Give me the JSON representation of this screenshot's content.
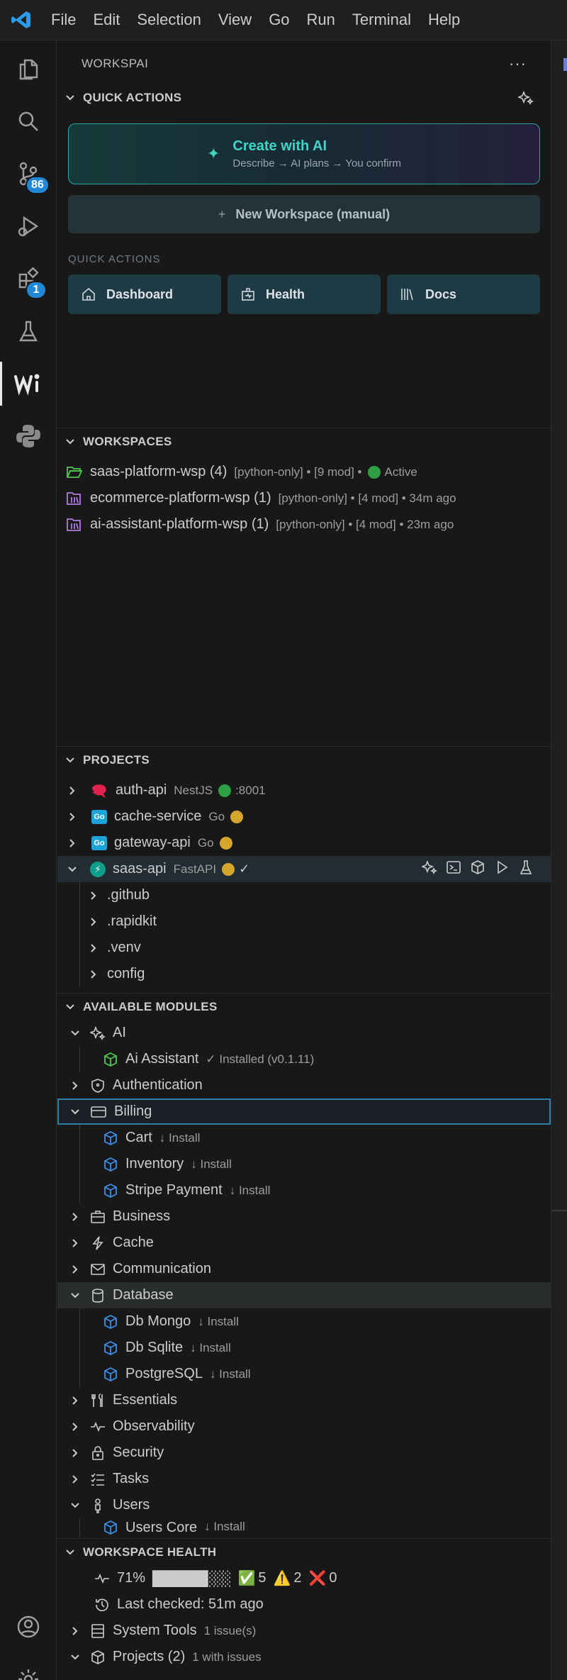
{
  "menu": [
    "File",
    "Edit",
    "Selection",
    "View",
    "Go",
    "Run",
    "Terminal",
    "Help"
  ],
  "activity": {
    "scm_badge": "86",
    "extensions_badge": "1"
  },
  "sidebar": {
    "title": "WORKSPAI",
    "more": "···"
  },
  "quick_actions": {
    "header": "QUICK ACTIONS",
    "create_ai_title": "Create with AI",
    "create_ai_subtitle": "Describe → AI plans → You confirm",
    "new_workspace": "New Workspace (manual)",
    "sublabel": "QUICK ACTIONS",
    "buttons": [
      "Dashboard",
      "Health",
      "Docs"
    ]
  },
  "workspaces": {
    "header": "WORKSPACES",
    "items": [
      {
        "name": "saas-platform-wsp (4)",
        "meta": "[python-only] • [9 mod] •",
        "status": "Active"
      },
      {
        "name": "ecommerce-platform-wsp (1)",
        "meta": "[python-only] • [4 mod] • 34m ago"
      },
      {
        "name": "ai-assistant-platform-wsp (1)",
        "meta": "[python-only] • [4 mod] • 23m ago"
      }
    ]
  },
  "projects": {
    "header": "PROJECTS",
    "items": [
      {
        "name": "auth-api",
        "framework": "NestJS",
        "port": ":8001"
      },
      {
        "name": "cache-service",
        "framework": "Go"
      },
      {
        "name": "gateway-api",
        "framework": "Go"
      },
      {
        "name": "saas-api",
        "framework": "FastAPI",
        "check": "✓"
      }
    ],
    "children": [
      ".github",
      ".rapidkit",
      ".venv",
      "config"
    ]
  },
  "modules": {
    "header": "AVAILABLE MODULES",
    "ai": "AI",
    "ai_assistant": "Ai Assistant",
    "ai_assistant_status": "✓ Installed (v0.1.11)",
    "authentication": "Authentication",
    "billing": "Billing",
    "billing_items": [
      {
        "name": "Cart",
        "action": "↓ Install"
      },
      {
        "name": "Inventory",
        "action": "↓ Install"
      },
      {
        "name": "Stripe Payment",
        "action": "↓ Install"
      }
    ],
    "business": "Business",
    "cache": "Cache",
    "communication": "Communication",
    "database": "Database",
    "database_items": [
      {
        "name": "Db Mongo",
        "action": "↓ Install"
      },
      {
        "name": "Db Sqlite",
        "action": "↓ Install"
      },
      {
        "name": "PostgreSQL",
        "action": "↓ Install"
      }
    ],
    "essentials": "Essentials",
    "observability": "Observability",
    "security": "Security",
    "tasks": "Tasks",
    "users": "Users",
    "users_core": "Users Core",
    "users_core_action": "↓ Install"
  },
  "health": {
    "header": "WORKSPACE HEALTH",
    "percent": "71%",
    "bar": "███████░░░",
    "progress_fraction": 0.71,
    "ok_count": "5",
    "warn_count": "2",
    "err_count": "0",
    "last_checked": "Last checked: 51m ago",
    "system_tools": "System Tools",
    "system_tools_meta": "1 issue(s)",
    "projects": "Projects (2)",
    "projects_meta": "1 with issues"
  },
  "colors": {
    "accent_teal": "#3fd6c8",
    "badge_blue": "#2188d8",
    "status_green": "#2ea043",
    "status_yellow": "#d4a72c",
    "module_blue": "#3b8eea"
  }
}
